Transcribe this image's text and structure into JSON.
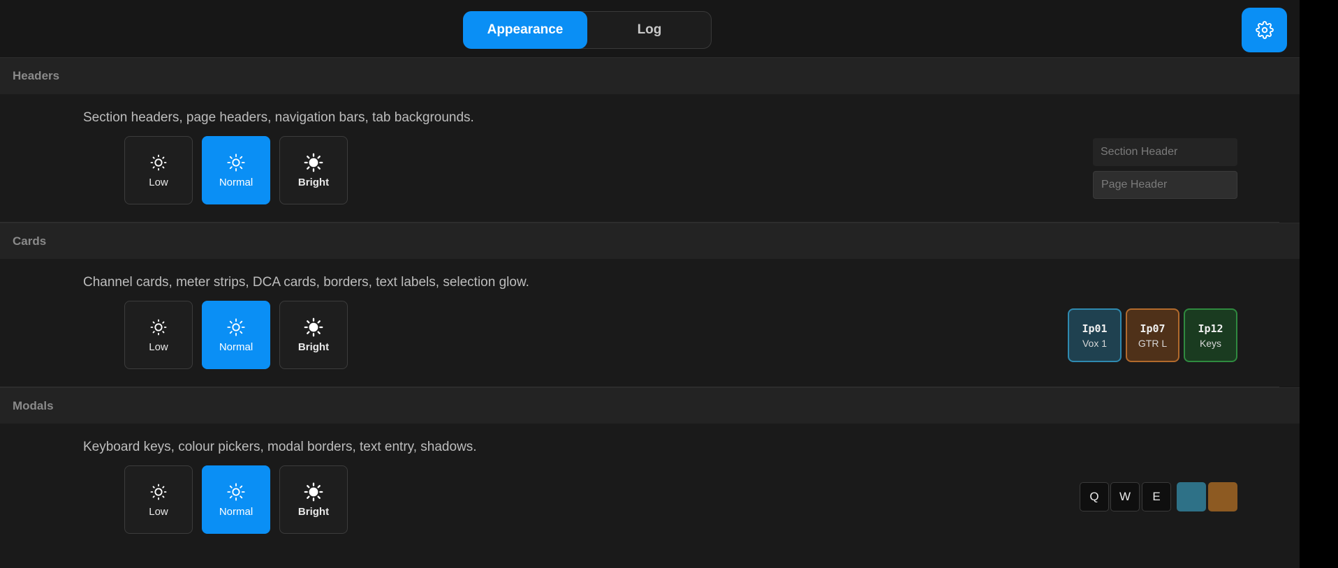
{
  "tabs": {
    "appearance": "Appearance",
    "log": "Log",
    "active": "Appearance"
  },
  "settings_icon": "gear-icon",
  "accent_color": "#0a8ff5",
  "sections": {
    "headers": {
      "title": "Headers",
      "description": "Section headers, page headers, navigation bars, tab backgrounds.",
      "options": [
        "Low",
        "Normal",
        "Bright"
      ],
      "selected": "Normal",
      "preview": {
        "section_header": "Section Header",
        "page_header": "Page Header"
      }
    },
    "cards": {
      "title": "Cards",
      "description": "Channel cards, meter strips, DCA cards, borders, text labels, selection glow.",
      "options": [
        "Low",
        "Normal",
        "Bright"
      ],
      "selected": "Normal",
      "preview": [
        {
          "id": "Ip01",
          "name": "Vox 1",
          "color": "#2f8ab0"
        },
        {
          "id": "Ip07",
          "name": "GTR L",
          "color": "#b26a2c"
        },
        {
          "id": "Ip12",
          "name": "Keys",
          "color": "#2f8a3f"
        }
      ]
    },
    "modals": {
      "title": "Modals",
      "description": "Keyboard keys, colour pickers, modal borders, text entry, shadows.",
      "options": [
        "Low",
        "Normal",
        "Bright"
      ],
      "selected": "Normal",
      "preview": {
        "keys": [
          "Q",
          "W",
          "E"
        ],
        "swatches": [
          "#2e7187",
          "#8d5a22"
        ]
      }
    }
  }
}
